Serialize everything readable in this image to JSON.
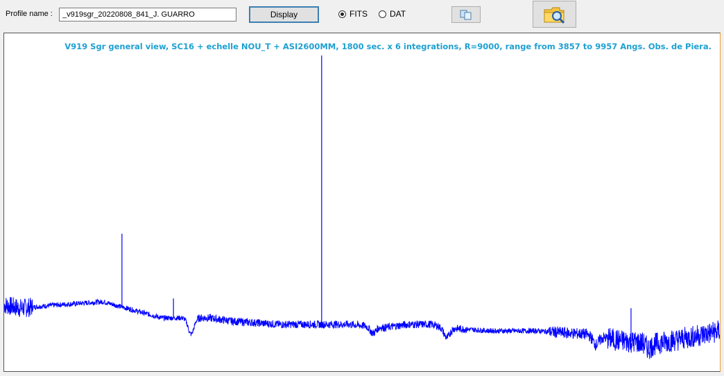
{
  "toolbar": {
    "profile_label": "Profile name :",
    "profile_value": "_v919sgr_20220808_841_J. GUARRO",
    "display_label": "Display",
    "radio_fits": "FITS",
    "radio_dat": "DAT",
    "selected_format": "FITS"
  },
  "colors": {
    "spectrum": "#0000ff",
    "title": "#1ea0d2",
    "plot_bg": "#ffffff",
    "accent": "#3c7fb1"
  },
  "chart_data": {
    "type": "line",
    "title": "V919 Sgr general view, SC16 + echelle NOU_T + ASI2600MM, 1800 sec. x 6 integrations, R=9000, range from 3857 to 9957 Angs.  Obs. de Piera.",
    "xlabel": "",
    "ylabel": "",
    "grid": false,
    "xlim": [
      3857,
      9957
    ],
    "ylim": [
      0,
      1
    ],
    "series": [
      {
        "continuum": [
          [
            3857,
            0.2
          ],
          [
            4000,
            0.19
          ],
          [
            4300,
            0.2
          ],
          [
            4700,
            0.21
          ],
          [
            5000,
            0.18
          ],
          [
            5200,
            0.16
          ],
          [
            5600,
            0.16
          ],
          [
            5800,
            0.15
          ],
          [
            6200,
            0.14
          ],
          [
            6563,
            0.14
          ],
          [
            6800,
            0.14
          ],
          [
            7100,
            0.13
          ],
          [
            7300,
            0.14
          ],
          [
            7500,
            0.14
          ],
          [
            7600,
            0.13
          ],
          [
            8000,
            0.12
          ],
          [
            8400,
            0.12
          ],
          [
            8800,
            0.11
          ],
          [
            9100,
            0.09
          ],
          [
            9400,
            0.08
          ],
          [
            9700,
            0.1
          ],
          [
            9957,
            0.12
          ]
        ],
        "emission_lines": [
          [
            4861,
            0.42
          ],
          [
            5300,
            0.22
          ],
          [
            6563,
            0.97
          ],
          [
            9200,
            0.19
          ]
        ],
        "absorption_features": [
          [
            5450,
            0.12
          ],
          [
            7000,
            0.06
          ],
          [
            7630,
            0.08
          ],
          [
            8900,
            0.07
          ],
          [
            9350,
            0.05
          ]
        ]
      }
    ]
  }
}
